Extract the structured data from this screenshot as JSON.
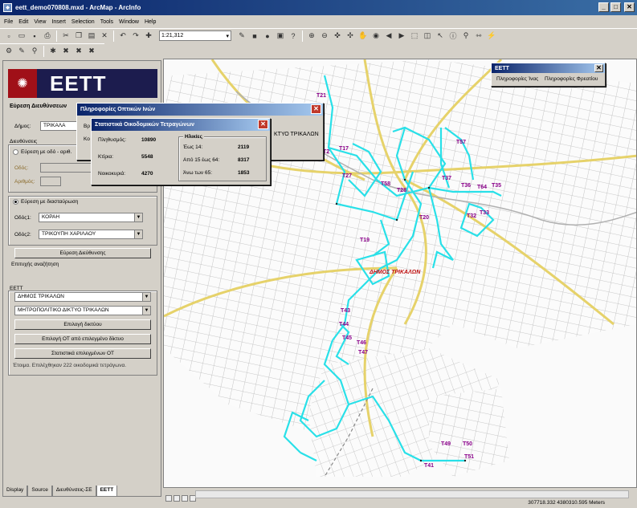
{
  "window": {
    "title": "eett_demo070808.mxd - ArcMap - ArcInfo",
    "icon": "arcmap-icon"
  },
  "menu": [
    "File",
    "Edit",
    "View",
    "Insert",
    "Selection",
    "Tools",
    "Window",
    "Help"
  ],
  "toolbar": {
    "scale": "1:21,312"
  },
  "left_panel": {
    "logo_text": "ΕΕΤΤ",
    "section_title": "Εύρεση Διευθύνσεων",
    "municipality_label": "Δήμος:",
    "municipality_value": "ΤΡΙΚΑΛΑ",
    "address_group_label": "Διευθύνσεις",
    "radio_street_label": "Εύρεση με οδό - αριθ.",
    "street_label": "Οδός:",
    "number_label": "Αριθμός:",
    "radio_intersection_label": "Εύρεση με διασταύρωση",
    "street1_label": "Οδός1:",
    "street1_value": "ΚΟΡΑΗ",
    "street2_label": "Οδός2:",
    "street2_value": "ΤΡΙΚΟΥΠΗ ΧΑΡΙΛΑΟΥ",
    "find_address_button": "Εύρεση Διεύθυνσης",
    "success_text": "Επιτυχής αναζήτηση",
    "eett_group_label": "ΕΕΤΤ",
    "eett_combo1": "ΔΗΜΟΣ ΤΡΙΚΑΛΩΝ",
    "eett_combo2": "ΜΗΤΡΟΠΟΛΙΤΙΚΟ ΔΙΚΤΥΟ ΤΡΙΚΑΛΩΝ",
    "select_network_button": "Επιλογή δικτύου",
    "select_ot_button": "Επιλογή ΟΤ από επιλεγμένο δίκτυο",
    "stats_button": "Στατιστικά επιλεγμένων ΟΤ",
    "result_text": "Έτοιμα. Επιλέχθηκαν 222 οικοδομικά τετράγωνα."
  },
  "tabs": [
    "Display",
    "Source",
    "Διευθύνσεις-ΣΕ",
    "ΕΕΤΤ"
  ],
  "dialog_fiber": {
    "title": "Πληροφορίες Οπτικών Ινών",
    "line1": "Βρ",
    "line2": "Κο",
    "right_text": "ΚΤΥΟ ΤΡΙΚΑΛΩΝ"
  },
  "dialog_stats": {
    "title": "Στατιστικά Οικοδομικών Τετραγώνων",
    "population_label": "Πληθυσμός:",
    "population_value": "10890",
    "buildings_label": "Κτίρια:",
    "buildings_value": "5548",
    "households_label": "Νοικοκυριά:",
    "households_value": "4270",
    "ages_title": "Ηλικίες",
    "age1_label": "Έως 14:",
    "age1_value": "2119",
    "age2_label": "Από 15 έως 64:",
    "age2_value": "8317",
    "age3_label": "Άνω των 65:",
    "age3_value": "1853"
  },
  "dialog_eett": {
    "title": "ΕΕΤΤ",
    "item1": "Πληροφορίες Ίνας",
    "item2": "Πληροφορίες Φρεατίου"
  },
  "map": {
    "city_label": "ΔΗΜΟΣ ΤΡΙΚΑΛΩΝ",
    "labels": [
      "T21",
      "T2",
      "T17",
      "T27",
      "T58",
      "T28",
      "T20",
      "T36",
      "T64",
      "T35",
      "T37",
      "T32",
      "T33",
      "T19",
      "T43",
      "T44",
      "T45",
      "T46",
      "T47",
      "T49",
      "T50",
      "T51",
      "T41",
      "T57"
    ]
  },
  "status": {
    "coords": "307718.332  4380310.595 Meters"
  }
}
